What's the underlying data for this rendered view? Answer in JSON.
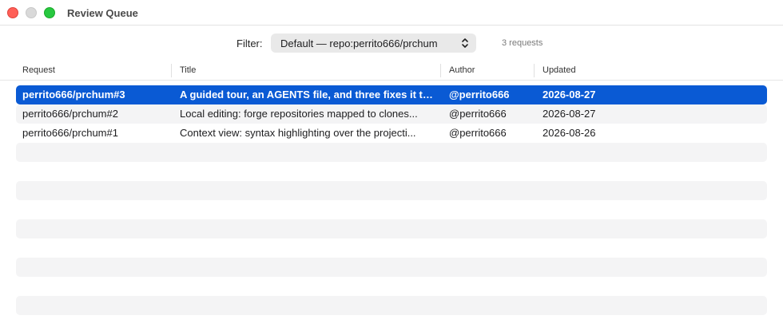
{
  "window": {
    "title": "Review Queue"
  },
  "filter": {
    "label": "Filter:",
    "selected": "Default — repo:perrito666/prchum",
    "count_text": "3 requests"
  },
  "table": {
    "columns": [
      "Request",
      "Title",
      "Author",
      "Updated"
    ],
    "rows": [
      {
        "request": "perrito666/prchum#3",
        "title": "A guided tour, an AGENTS file, and three fixes it tu...",
        "author": "@perrito666",
        "updated": "2026-08-27",
        "selected": true
      },
      {
        "request": "perrito666/prchum#2",
        "title": "Local editing: forge repositories mapped to clones...",
        "author": "@perrito666",
        "updated": "2026-08-27",
        "selected": false
      },
      {
        "request": "perrito666/prchum#1",
        "title": "Context view: syntax highlighting over the projecti...",
        "author": "@perrito666",
        "updated": "2026-08-26",
        "selected": false
      }
    ]
  },
  "colors": {
    "selection": "#0a5ad4",
    "stripe": "#f4f4f5"
  },
  "icons": {
    "filter_chevron": "chevron-up-down-icon"
  }
}
